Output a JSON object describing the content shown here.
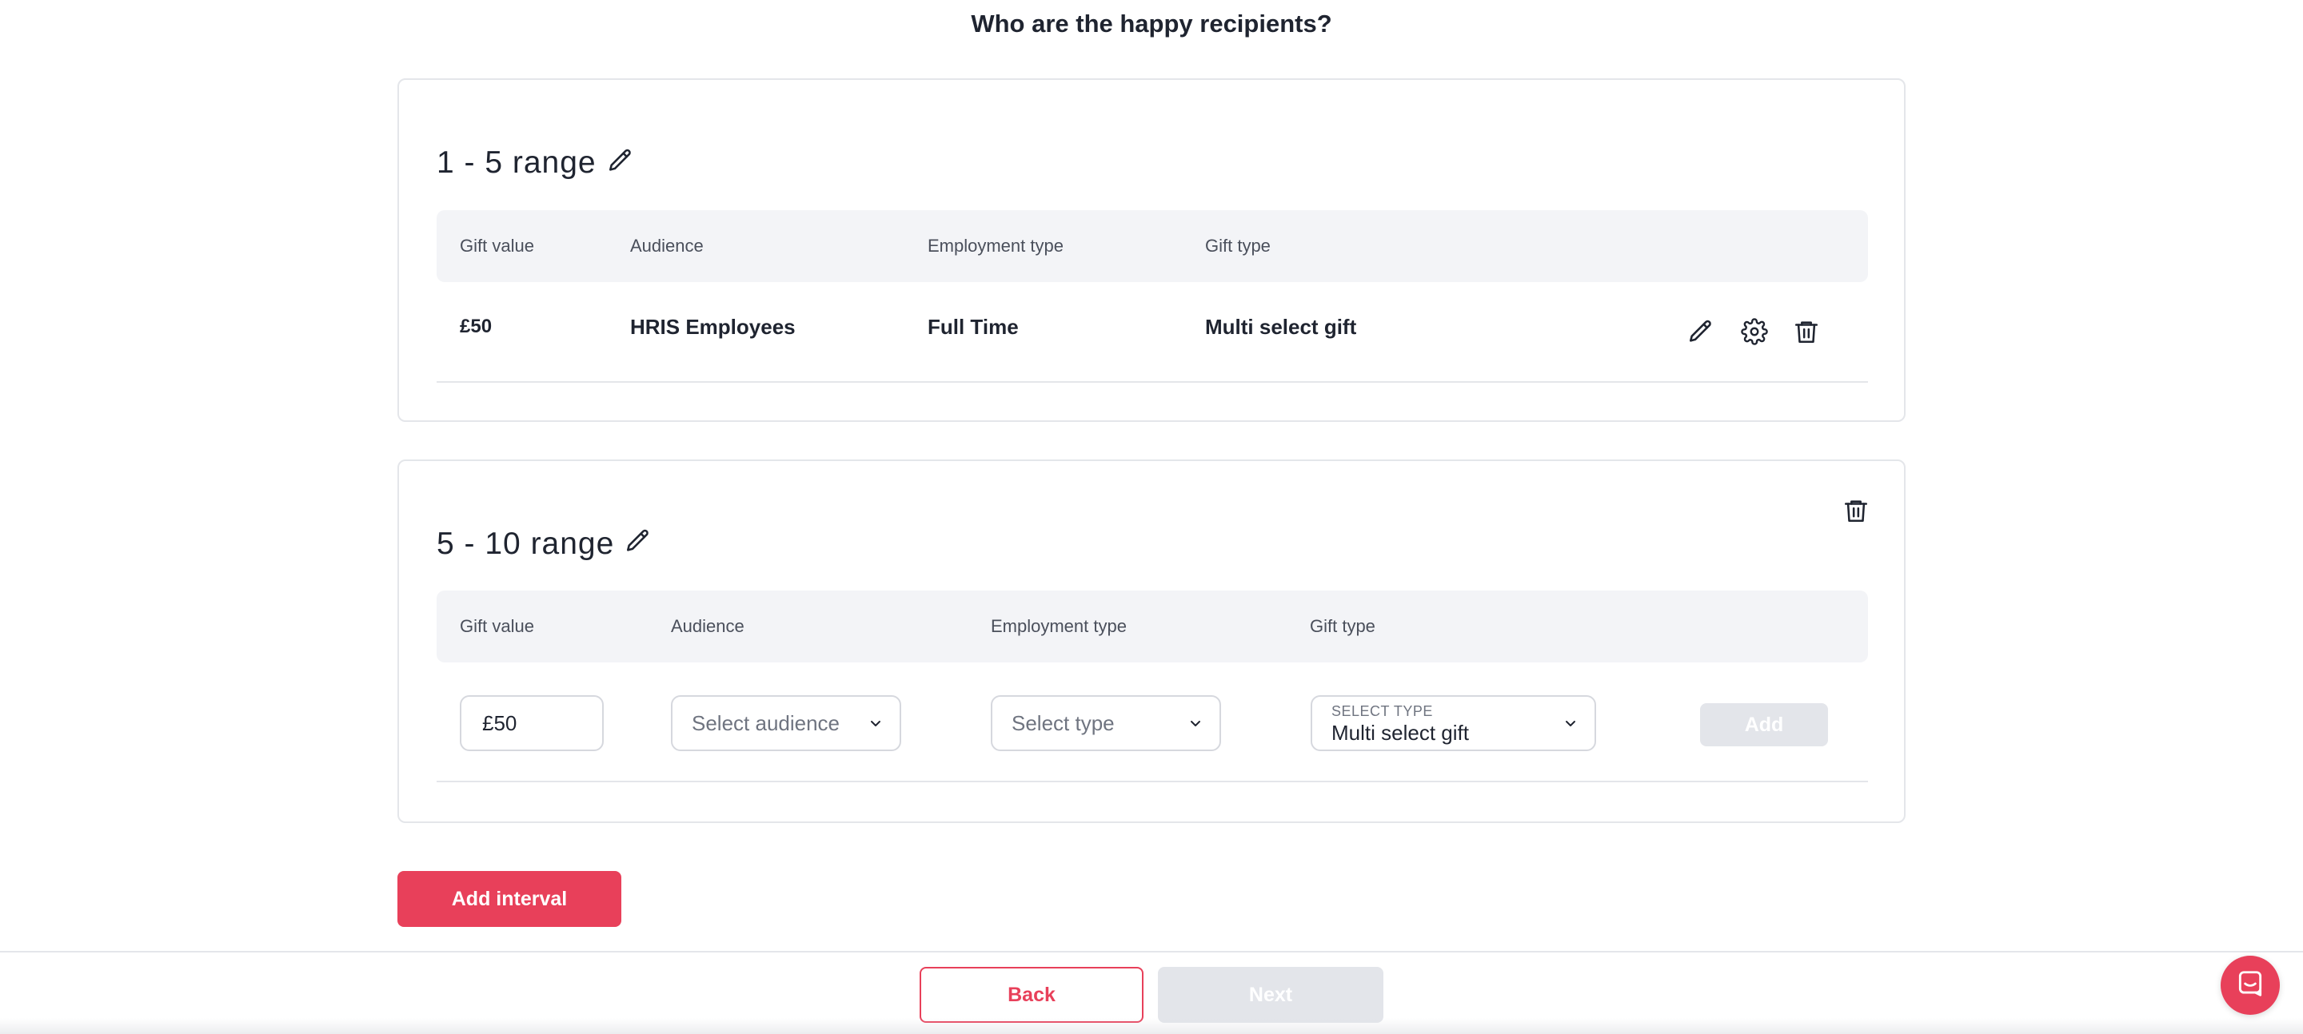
{
  "page": {
    "heading": "Who are the happy recipients?"
  },
  "ranges": [
    {
      "title": "1 - 5  range",
      "columns": [
        "Gift value",
        "Audience",
        "Employment type",
        "Gift type"
      ],
      "row": {
        "gift_value": "£50",
        "audience": "HRIS Employees",
        "employment_type": "Full Time",
        "gift_type": "Multi select gift"
      },
      "icons": [
        "pencil-icon",
        "gear-icon",
        "trash-icon"
      ]
    },
    {
      "title": "5 - 10  range",
      "columns": [
        "Gift value",
        "Audience",
        "Employment type",
        "Gift type"
      ],
      "form": {
        "gift_value": "£50",
        "audience_placeholder": "Select audience",
        "employment_placeholder": "Select type",
        "gift_type_label": "SELECT TYPE",
        "gift_type_value": "Multi select gift",
        "add_label": "Add"
      },
      "icons": [
        "pencil-icon",
        "trash-icon"
      ]
    }
  ],
  "actions": {
    "add_interval": "Add interval"
  },
  "footer": {
    "back": "Back",
    "next": "Next"
  },
  "colors": {
    "accent": "#e8405a",
    "disabled": "#e3e5ea",
    "table_header_bg": "#f3f4f7",
    "border": "#e4e6ea"
  }
}
